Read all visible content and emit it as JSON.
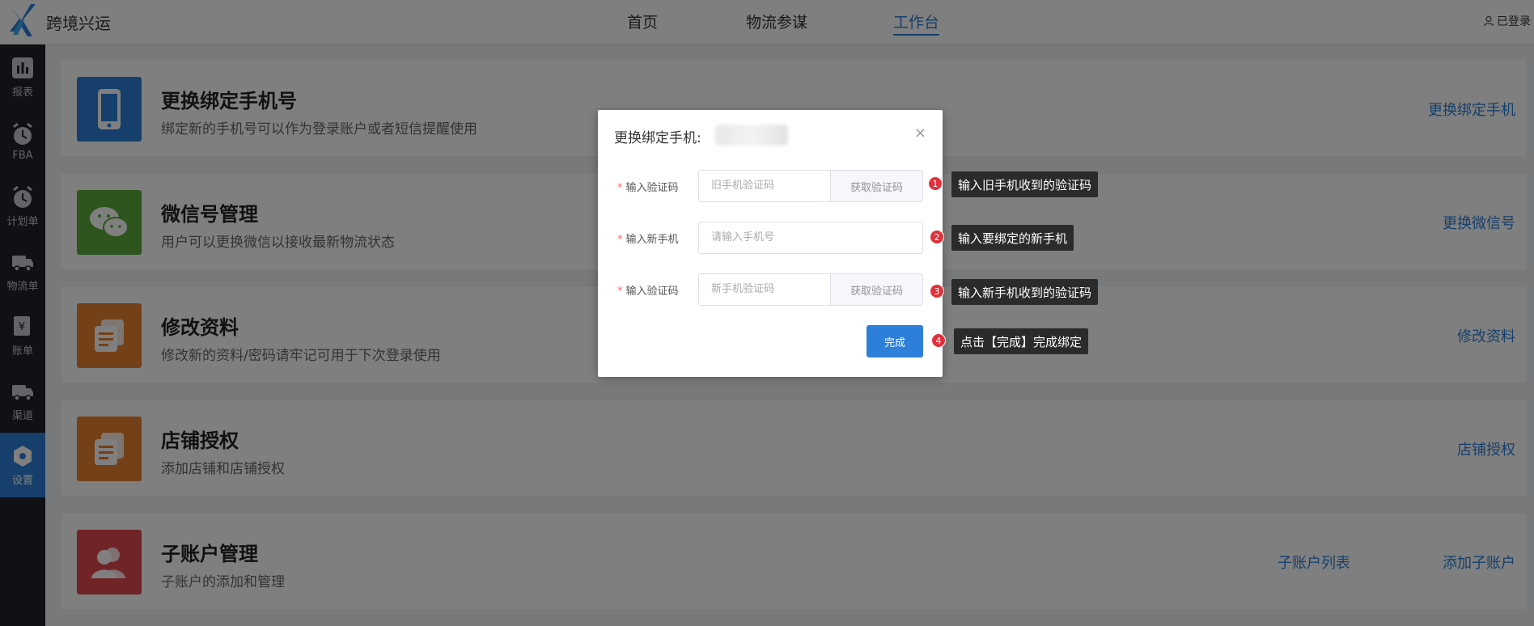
{
  "header": {
    "app_title": "跨境兴运",
    "nav": [
      {
        "label": "首页"
      },
      {
        "label": "物流参谋"
      },
      {
        "label": "工作台"
      }
    ],
    "login_label": "已登录"
  },
  "sidebar": {
    "items": [
      {
        "label": "报表"
      },
      {
        "label": "FBA"
      },
      {
        "label": "计划单"
      },
      {
        "label": "物流单"
      },
      {
        "label": "账单"
      },
      {
        "label": "渠道"
      },
      {
        "label": "设置"
      }
    ]
  },
  "cards": [
    {
      "title": "更换绑定手机号",
      "desc": "绑定新的手机号可以作为登录账户或者短信提醒使用",
      "links": [
        "更换绑定手机"
      ],
      "color": "#2d7fd9"
    },
    {
      "title": "微信号管理",
      "desc": "用户可以更换微信以接收最新物流状态",
      "links": [
        "更换微信号"
      ],
      "color": "#5aab3a"
    },
    {
      "title": "修改资料",
      "desc": "修改新的资料/密码请牢记可用于下次登录使用",
      "links": [
        "修改资料"
      ],
      "color": "#e8802f"
    },
    {
      "title": "店铺授权",
      "desc": "添加店铺和店铺授权",
      "links": [
        "店铺授权"
      ],
      "color": "#e8802f"
    },
    {
      "title": "子账户管理",
      "desc": "子账户的添加和管理",
      "links": [
        "子账户列表",
        "添加子账户"
      ],
      "color": "#e0484f"
    }
  ],
  "modal": {
    "title": "更换绑定手机:",
    "close_icon": "×",
    "rows": [
      {
        "label": "输入验证码",
        "placeholder": "旧手机验证码",
        "button": "获取验证码"
      },
      {
        "label": "输入新手机",
        "placeholder": "请输入手机号"
      },
      {
        "label": "输入验证码",
        "placeholder": "新手机验证码",
        "button": "获取验证码"
      }
    ],
    "done_label": "完成"
  },
  "steps": [
    {
      "num": "1",
      "text": "输入旧手机收到的验证码"
    },
    {
      "num": "2",
      "text": "输入要绑定的新手机"
    },
    {
      "num": "3",
      "text": "输入新手机收到的验证码"
    },
    {
      "num": "4",
      "text": "点击【完成】完成绑定"
    }
  ]
}
